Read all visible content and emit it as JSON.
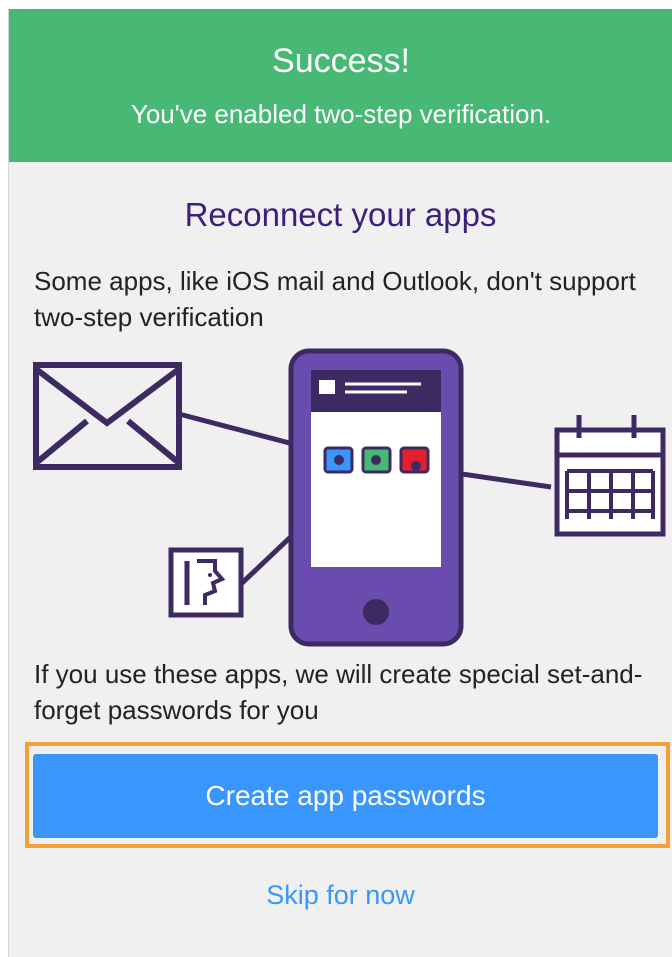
{
  "banner": {
    "title": "Success!",
    "subtitle": "You've enabled two-step verification."
  },
  "main": {
    "heading": "Reconnect your apps",
    "intro": "Some apps, like iOS mail and Outlook, don't support two-step verification",
    "explanation": "If you use these apps, we will create special set-and-forget passwords for you"
  },
  "actions": {
    "primary_label": "Create app passwords",
    "skip_label": "Skip for now"
  },
  "illustration": {
    "icons": [
      "envelope-icon",
      "contacts-card-icon",
      "calendar-icon",
      "phone-icon"
    ],
    "app_tile_colors": [
      "#3996fc",
      "#48b975",
      "#e2202f"
    ]
  },
  "colors": {
    "banner": "#48b975",
    "heading": "#3d1f7b",
    "accent": "#3996fc",
    "phone": "#6a4cae",
    "highlight": "#f2a13a"
  }
}
